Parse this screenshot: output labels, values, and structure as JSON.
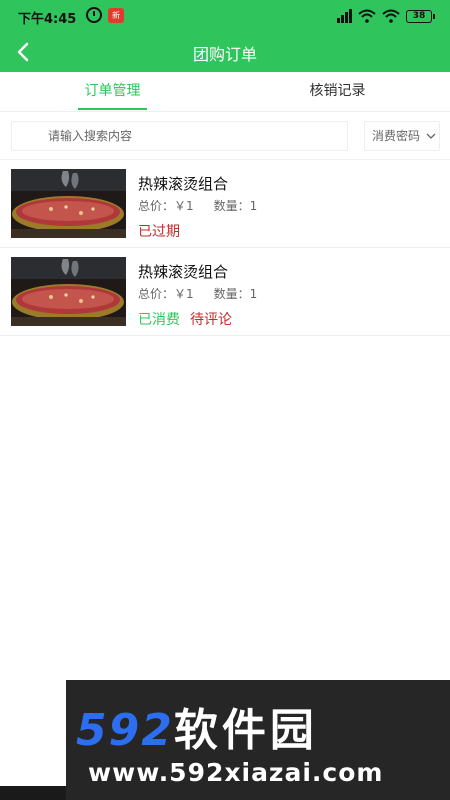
{
  "statusbar": {
    "time": "下午4:45",
    "notif_text": "新",
    "battery": "38"
  },
  "navbar": {
    "title": "团购订单"
  },
  "tabs": [
    {
      "label": "订单管理",
      "active": true
    },
    {
      "label": "核销记录",
      "active": false
    }
  ],
  "search": {
    "placeholder": "请输入搜索内容"
  },
  "filter": {
    "label": "消费密码"
  },
  "orders": [
    {
      "name": "热辣滚烫组合",
      "total_label": "总价：￥1",
      "qty_label": "数量：1",
      "status": [
        "已过期"
      ]
    },
    {
      "name": "热辣滚烫组合",
      "total_label": "总价：￥1",
      "qty_label": "数量：1",
      "status": [
        "已消费",
        "待评论"
      ]
    }
  ],
  "watermark": {
    "brand_num": "592",
    "brand_cn": "软件园",
    "url": "www.592xiazai.com"
  },
  "colors": {
    "accent": "#2fc45c",
    "expired": "#c62b2b",
    "pending": "#c62b2b"
  }
}
